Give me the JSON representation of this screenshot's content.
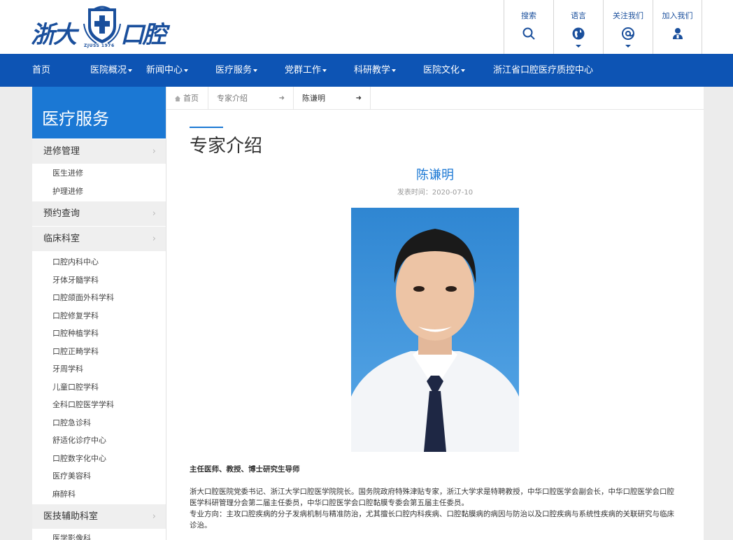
{
  "logo": {
    "left": "浙大",
    "right": "口腔",
    "sub": "ZJUSS 1976"
  },
  "topnav": [
    {
      "label": "搜索",
      "icon": "search-icon",
      "caret": false
    },
    {
      "label": "语言",
      "icon": "globe-icon",
      "caret": true
    },
    {
      "label": "关注我们",
      "icon": "at-icon",
      "caret": true
    },
    {
      "label": "加入我们",
      "icon": "user-icon",
      "caret": false
    }
  ],
  "mainnav": [
    {
      "label": "首页",
      "caret": false
    },
    {
      "label": "医院概况",
      "caret": true
    },
    {
      "label": "新闻中心",
      "caret": true
    },
    {
      "label": "医疗服务",
      "caret": true
    },
    {
      "label": "党群工作",
      "caret": true
    },
    {
      "label": "科研教学",
      "caret": true
    },
    {
      "label": "医院文化",
      "caret": true
    },
    {
      "label": "浙江省口腔医疗质控中心",
      "caret": false
    }
  ],
  "sidebar": {
    "title": "医疗服务",
    "groups": [
      {
        "label": "进修管理",
        "items": [
          "医生进修",
          "护理进修"
        ]
      },
      {
        "label": "预约查询",
        "items": []
      },
      {
        "label": "临床科室",
        "items": [
          "口腔内科中心",
          "牙体牙髓学科",
          "口腔颌面外科学科",
          "口腔修复学科",
          "口腔种植学科",
          "口腔正畸学科",
          "牙周学科",
          "儿童口腔学科",
          "全科口腔医学学科",
          "口腔急诊科",
          "舒适化诊疗中心",
          "口腔数字化中心",
          "医疗美容科",
          "麻醉科"
        ]
      },
      {
        "label": "医技辅助科室",
        "items": [
          "医学影像科"
        ]
      }
    ]
  },
  "breadcrumb": {
    "home": "首页",
    "section": "专家介绍",
    "current": "陈谦明"
  },
  "section_title": "专家介绍",
  "article": {
    "title": "陈谦明",
    "date": "发表时间：2020-07-10",
    "role": "主任医师、教授、博士研究生导师",
    "para1": "浙大口腔医院党委书记、浙江大学口腔医学院院长。国务院政府特殊津贴专家，浙江大学求是特聘教授，中华口腔医学会副会长，中华口腔医学会口腔医学科研管理分会第二届主任委员，中华口腔医学会口腔黏膜专委会第五届主任委员。",
    "para2": "专业方向：主攻口腔疾病的分子发病机制与精准防治，尤其擅长口腔内科疾病、口腔黏膜病的病因与防治以及口腔疾病与系统性疾病的关联研究与临床诊治。"
  },
  "colors": {
    "brand": "#0d54b4",
    "accent": "#1b78d4",
    "link": "#1a4f9c"
  }
}
